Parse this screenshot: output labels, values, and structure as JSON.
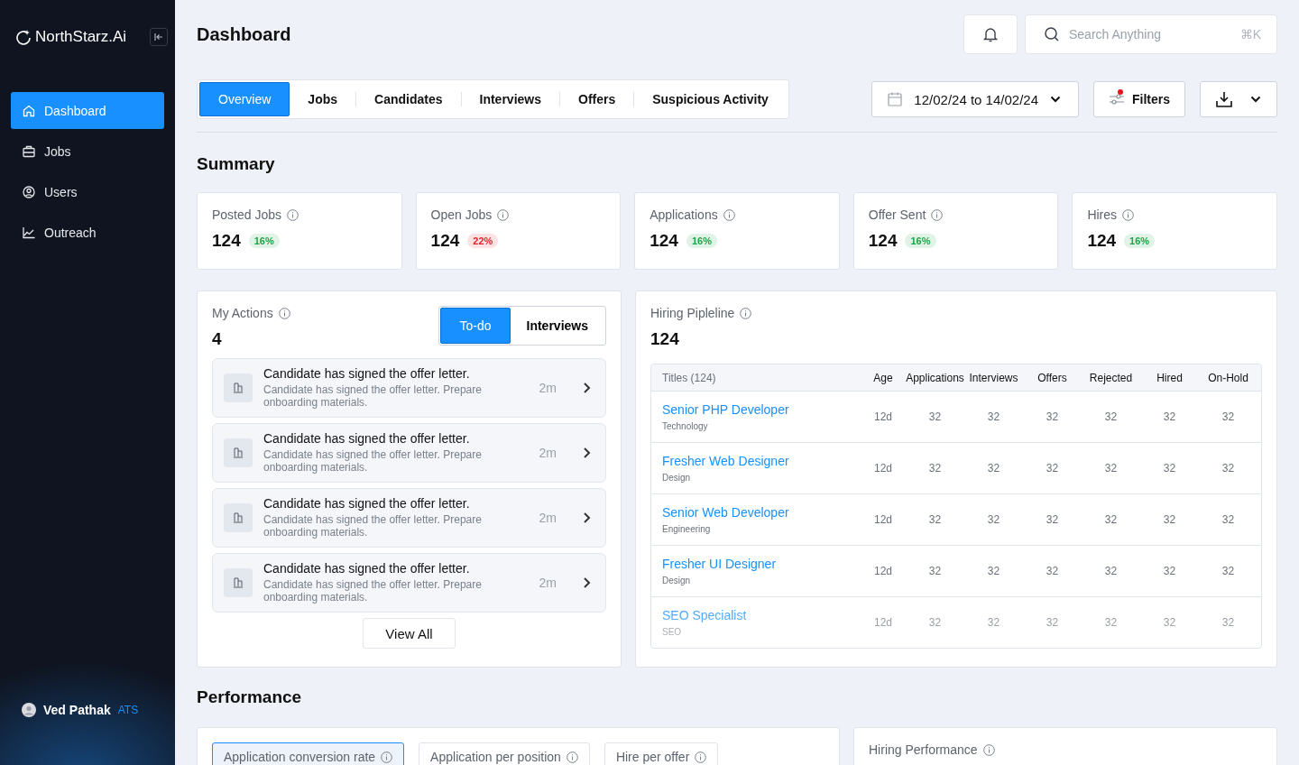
{
  "brand": {
    "name": "NorthStarz.Ai"
  },
  "sidebar": {
    "items": [
      {
        "label": "Dashboard",
        "selected": true
      },
      {
        "label": "Jobs",
        "selected": false
      },
      {
        "label": "Users",
        "selected": false
      },
      {
        "label": "Outreach",
        "selected": false
      }
    ],
    "user": {
      "name": "Ved Pathak",
      "tag": "ATS"
    }
  },
  "header": {
    "title": "Dashboard",
    "search": {
      "placeholder": "Search Anything",
      "shortcut": "⌘K"
    }
  },
  "tabs": [
    {
      "label": "Overview",
      "selected": true
    },
    {
      "label": "Jobs",
      "selected": false
    },
    {
      "label": "Candidates",
      "selected": false
    },
    {
      "label": "Interviews",
      "selected": false
    },
    {
      "label": "Offers",
      "selected": false
    },
    {
      "label": "Suspicious Activity",
      "selected": false
    }
  ],
  "toolbar": {
    "date_range": "12/02/24 to 14/02/24",
    "filters": {
      "label": "Filters",
      "indicator": true
    }
  },
  "summary": {
    "title": "Summary",
    "cards": [
      {
        "label": "Posted Jobs",
        "value": "124",
        "change": "16%",
        "color": "#1ea446"
      },
      {
        "label": "Open Jobs",
        "value": "124",
        "change": "22%",
        "color": "#e5262d"
      },
      {
        "label": "Applications",
        "value": "124",
        "change": "16%",
        "color": "#1ea446"
      },
      {
        "label": "Offer Sent",
        "value": "124",
        "change": "16%",
        "color": "#1ea446"
      },
      {
        "label": "Hires",
        "value": "124",
        "change": "16%",
        "color": "#1ea446"
      }
    ]
  },
  "my_actions": {
    "title": "My Actions",
    "count": "4",
    "toggle": [
      {
        "label": "To-do",
        "selected": true
      },
      {
        "label": "Interviews",
        "selected": false
      }
    ],
    "items": [
      {
        "title": "Candidate has signed the offer letter.",
        "text": "Candidate has signed the offer letter. Prepare onboarding materials.",
        "time": "2m"
      },
      {
        "title": "Candidate has signed the offer letter.",
        "text": "Candidate has signed the offer letter. Prepare onboarding materials.",
        "time": "2m"
      },
      {
        "title": "Candidate has signed the offer letter.",
        "text": "Candidate has signed the offer letter. Prepare onboarding materials.",
        "time": "2m"
      },
      {
        "title": "Candidate has signed the offer letter.",
        "text": "Candidate has signed the offer letter. Prepare onboarding materials.",
        "time": "2m"
      }
    ],
    "view_all": "View All"
  },
  "hiring_pipeline": {
    "title": "Hiring Pipleline",
    "count": "124",
    "table": {
      "columns": [
        "Titles (124)",
        "Age",
        "Applications",
        "Interviews",
        "Offers",
        "Rejected",
        "Hired",
        "On-Hold"
      ],
      "rows": [
        {
          "title": "Senior PHP Developer",
          "department": "Technology",
          "age": "12d",
          "values": [
            "32",
            "32",
            "32",
            "32",
            "32",
            "32"
          ]
        },
        {
          "title": "Fresher Web Designer",
          "department": "Design",
          "age": "12d",
          "values": [
            "32",
            "32",
            "32",
            "32",
            "32",
            "32"
          ]
        },
        {
          "title": "Senior Web Developer",
          "department": "Engineering",
          "age": "12d",
          "values": [
            "32",
            "32",
            "32",
            "32",
            "32",
            "32"
          ]
        },
        {
          "title": "Fresher UI Designer",
          "department": "Design",
          "age": "12d",
          "values": [
            "32",
            "32",
            "32",
            "32",
            "32",
            "32"
          ]
        },
        {
          "title": "SEO Specialist",
          "department": "SEO",
          "age": "12d",
          "values": [
            "32",
            "32",
            "32",
            "32",
            "32",
            "32"
          ]
        }
      ]
    }
  },
  "performance": {
    "title": "Performance",
    "tabs": [
      {
        "label": "Application conversion rate",
        "selected": true
      },
      {
        "label": "Application per position",
        "selected": false
      },
      {
        "label": "Hire per offer",
        "selected": false
      }
    ],
    "hiring_performance": {
      "title": "Hiring Performance"
    }
  }
}
